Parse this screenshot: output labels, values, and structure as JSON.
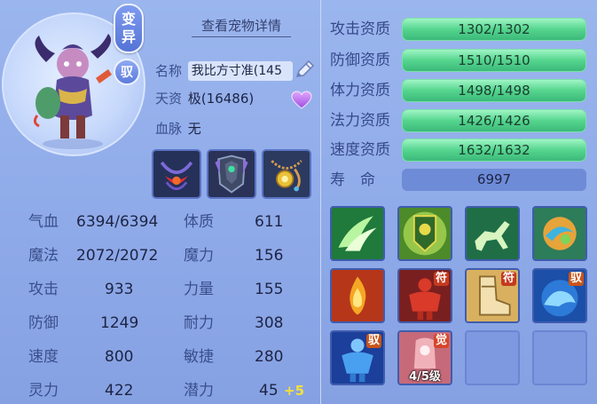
{
  "pet": {
    "variant_badge": [
      "变",
      "异"
    ],
    "yu_badge": "驭",
    "detail_link": "查看宠物详情",
    "name_label": "名称",
    "name_value": "我比方寸准(145",
    "aptitude_label": "天资",
    "aptitude_value": "极(16486)",
    "bloodline_label": "血脉",
    "bloodline_value": "无"
  },
  "equipment": [
    {
      "name": "collar-equipment"
    },
    {
      "name": "armor-equipment"
    },
    {
      "name": "amulet-equipment"
    }
  ],
  "attributes_left": [
    {
      "label": "气血",
      "value": "6394/6394"
    },
    {
      "label": "魔法",
      "value": "2072/2072"
    },
    {
      "label": "攻击",
      "value": "933"
    },
    {
      "label": "防御",
      "value": "1249"
    },
    {
      "label": "速度",
      "value": "800"
    },
    {
      "label": "灵力",
      "value": "422"
    }
  ],
  "attributes_right": [
    {
      "label": "体质",
      "value": "611"
    },
    {
      "label": "魔力",
      "value": "156"
    },
    {
      "label": "力量",
      "value": "155"
    },
    {
      "label": "耐力",
      "value": "308"
    },
    {
      "label": "敏捷",
      "value": "280"
    },
    {
      "label": "潜力",
      "value": "45",
      "bonus": "+5"
    }
  ],
  "aptitudes": [
    {
      "label": "攻击资质",
      "value": "1302/1302"
    },
    {
      "label": "防御资质",
      "value": "1510/1510"
    },
    {
      "label": "体力资质",
      "value": "1498/1498"
    },
    {
      "label": "法力资质",
      "value": "1426/1426"
    },
    {
      "label": "速度资质",
      "value": "1632/1632"
    }
  ],
  "lifespan": {
    "label": "寿　命",
    "value": "6997"
  },
  "skills": {
    "tag_fu": "符",
    "tag_yu": "驭",
    "tag_jue": "觉",
    "jue_level": "4/5级"
  },
  "colors": {
    "background": "#8ea9e8",
    "aptitude_bar": "#55d58e",
    "potential_bonus": "#f5e03a"
  }
}
